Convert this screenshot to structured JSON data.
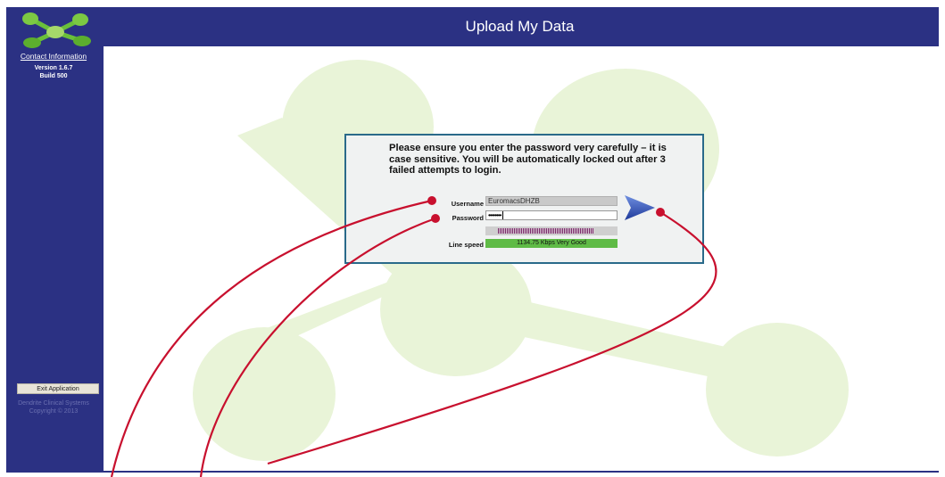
{
  "header": {
    "title": "Upload My Data"
  },
  "sidebar": {
    "contact_link": "Contact Information",
    "version": "Version 1.6.7",
    "build": "Build 500",
    "exit_button": "Exit Application",
    "company": "Dendrite Clinical Systems",
    "copyright": "Copyright © 2013"
  },
  "login": {
    "warning": "Please ensure you enter the password very carefully – it is case sensitive.  You will be automatically locked out after 3 failed attempts to login.",
    "username_label": "Username",
    "username_value": "EuromacsDHZB",
    "password_label": "Password",
    "password_value": "••••••••",
    "line_speed_label": "Line speed",
    "line_speed_value": "1134.75 Kbps Very Good",
    "progress_fraction": 0.9
  },
  "colors": {
    "frame": "#2b3183",
    "line_speed_bar": "#5fbb46",
    "annotation": "#c8102e",
    "dialog_border": "#2a6a8a"
  },
  "icons": {
    "logo": "molecule-logo",
    "submit": "right-arrow-icon"
  }
}
